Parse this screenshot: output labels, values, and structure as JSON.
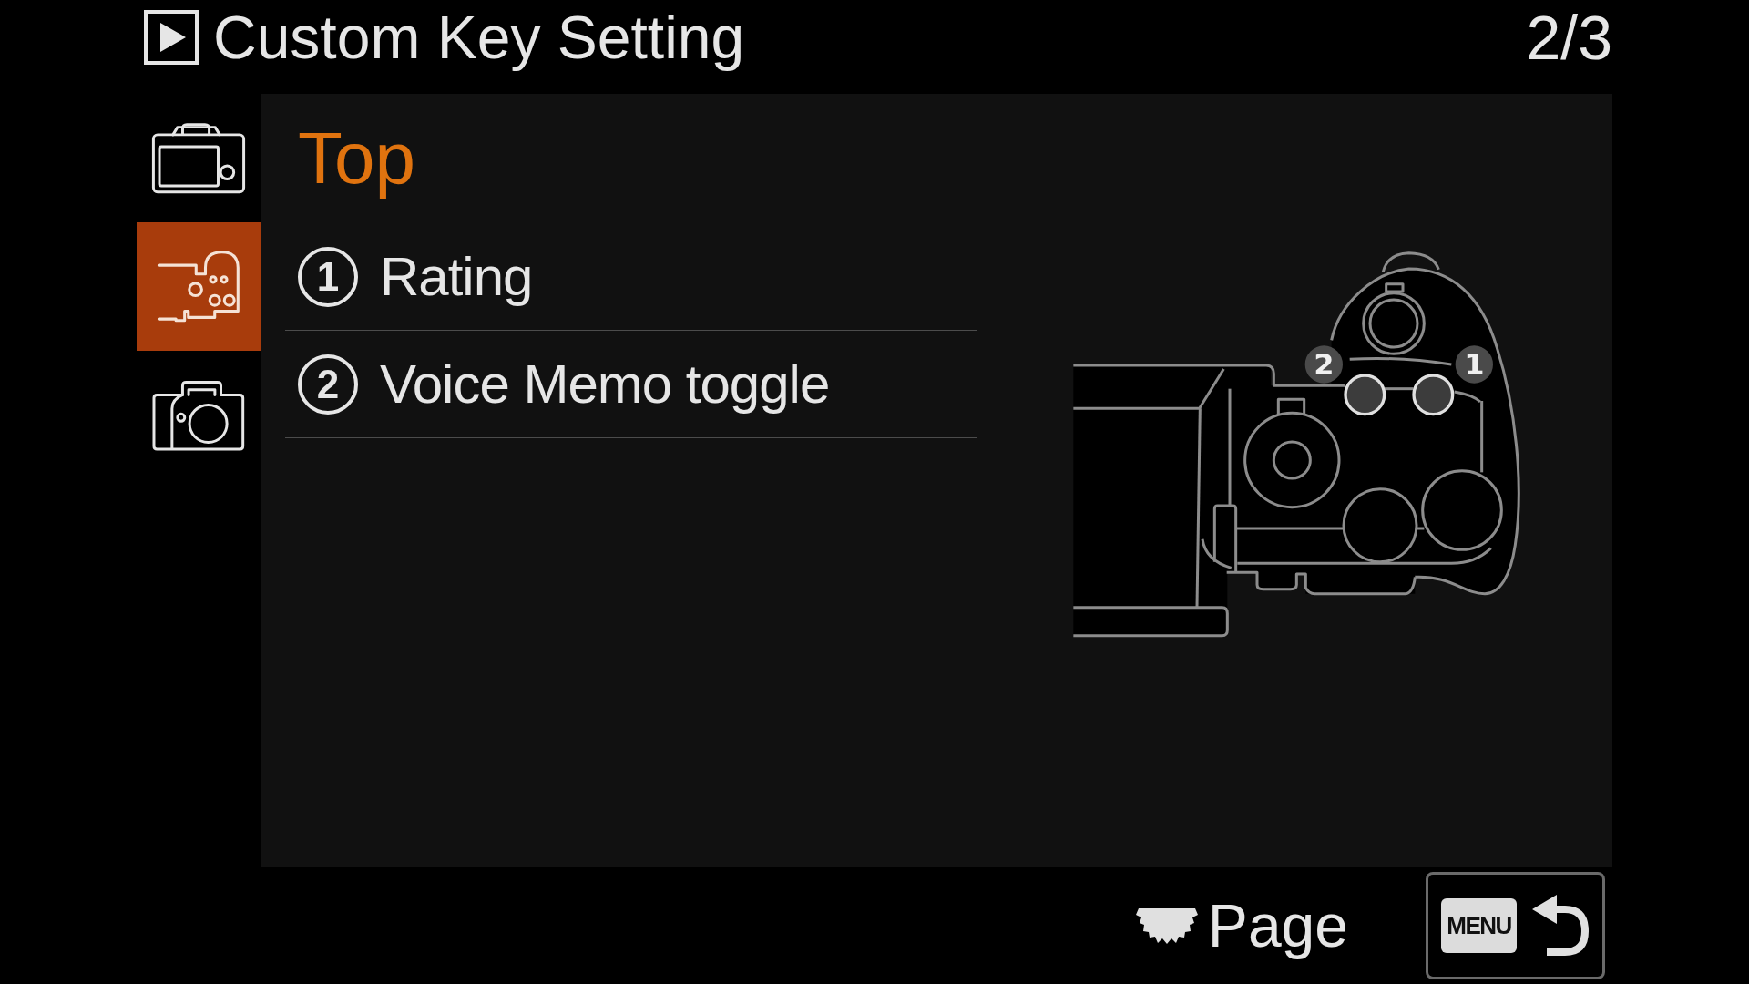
{
  "header": {
    "title": "Custom Key Setting",
    "page_indicator": "2/3"
  },
  "sidebar": {
    "tabs": [
      {
        "kind": "rear",
        "selected": false
      },
      {
        "kind": "top",
        "selected": true
      },
      {
        "kind": "front",
        "selected": false
      }
    ]
  },
  "panel": {
    "heading": "Top",
    "items": [
      {
        "number": "1",
        "label": "Rating"
      },
      {
        "number": "2",
        "label": "Voice Memo toggle"
      }
    ],
    "illustration": {
      "callouts": [
        {
          "label": "2"
        },
        {
          "label": "1"
        }
      ]
    }
  },
  "footer": {
    "page_hint": "Page",
    "back_button": {
      "key_label": "MENU"
    }
  }
}
